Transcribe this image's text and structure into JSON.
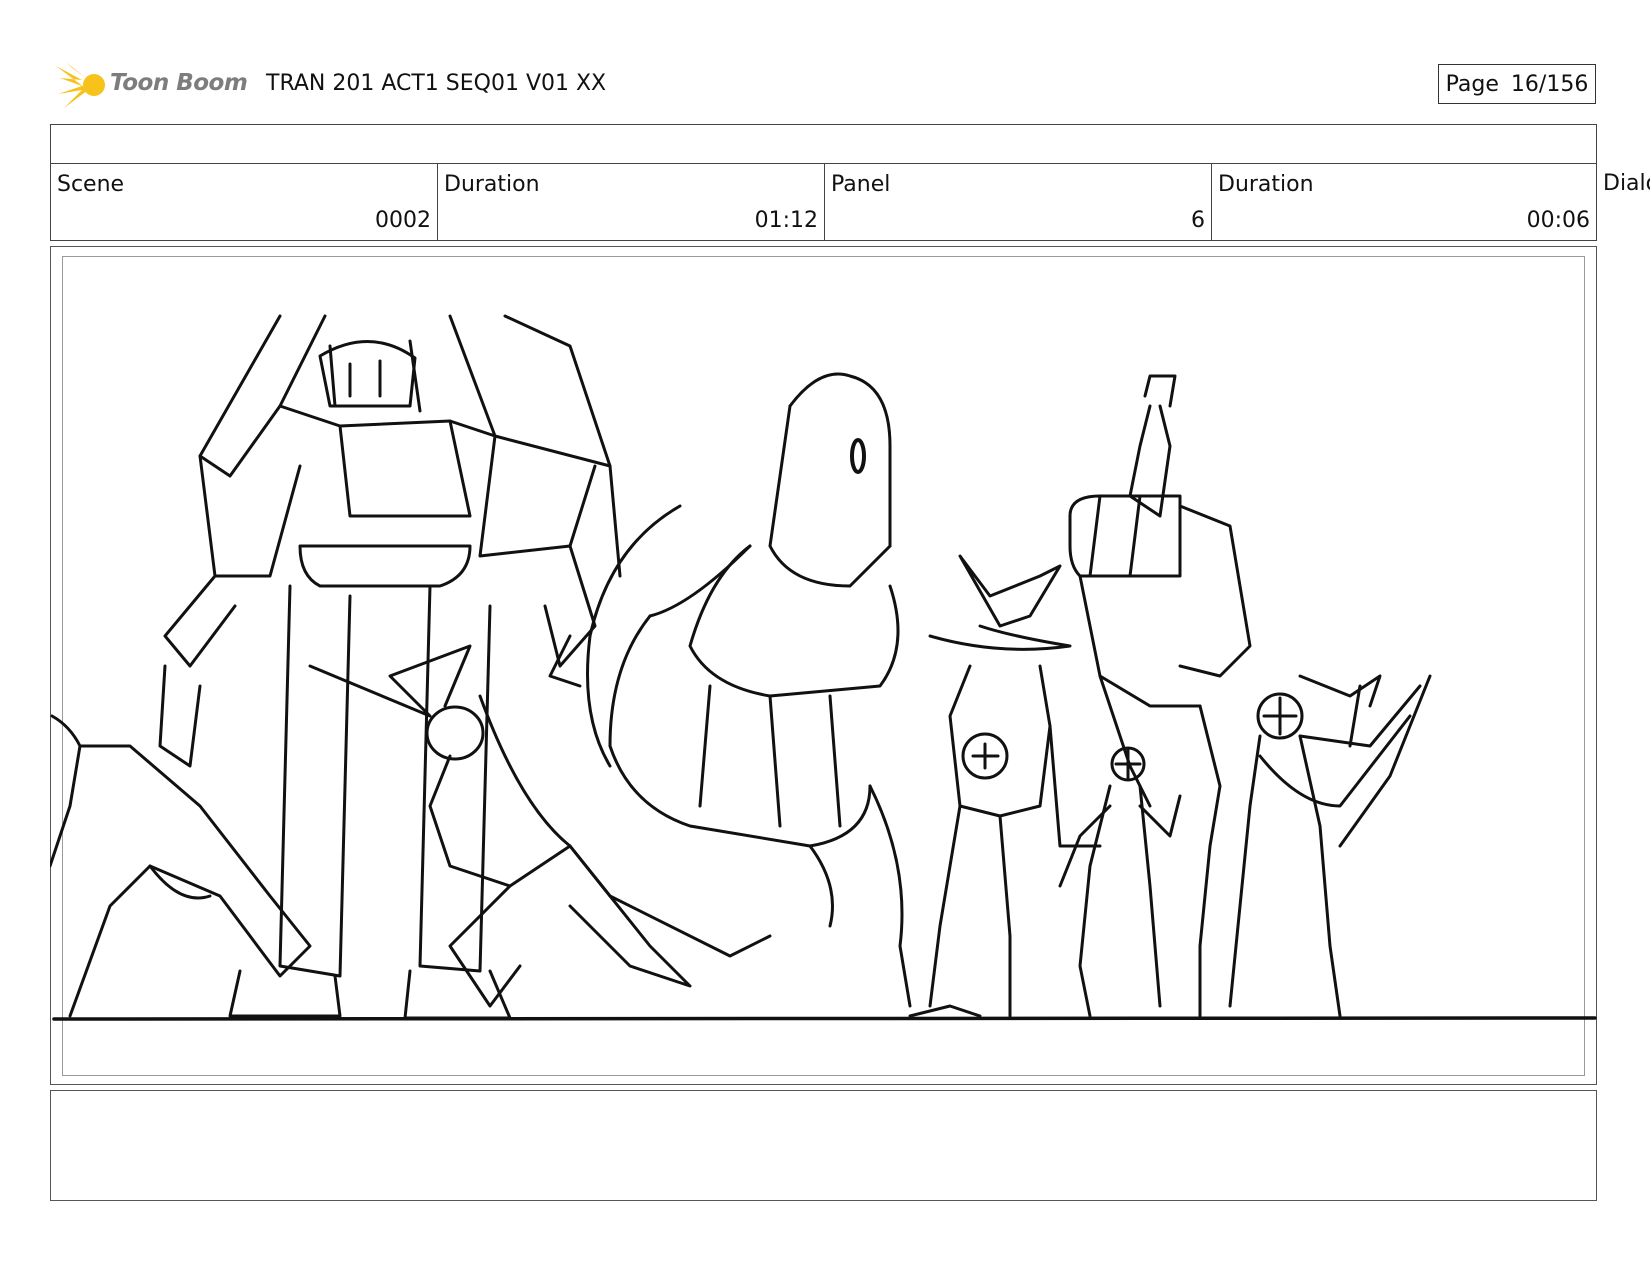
{
  "header": {
    "logo_text": "Toon Boom",
    "doc_title": "TRAN 201 ACT1 SEQ01 V01 XX",
    "page_label": "Page",
    "page_value": "16/156"
  },
  "info": {
    "scene_label": "Scene",
    "scene_value": "0002",
    "duration_label": "Duration",
    "duration_value": "01:12",
    "panel_label": "Panel",
    "panel_value": "6",
    "panel_duration_label": "Duration",
    "panel_duration_value": "00:06",
    "dialog_label": "Dialo"
  },
  "colors": {
    "logo_accent": "#f7c21a",
    "logo_text": "#7d7d7d",
    "ink": "#111111"
  },
  "icons": [
    "toon-boom-logo-icon"
  ]
}
